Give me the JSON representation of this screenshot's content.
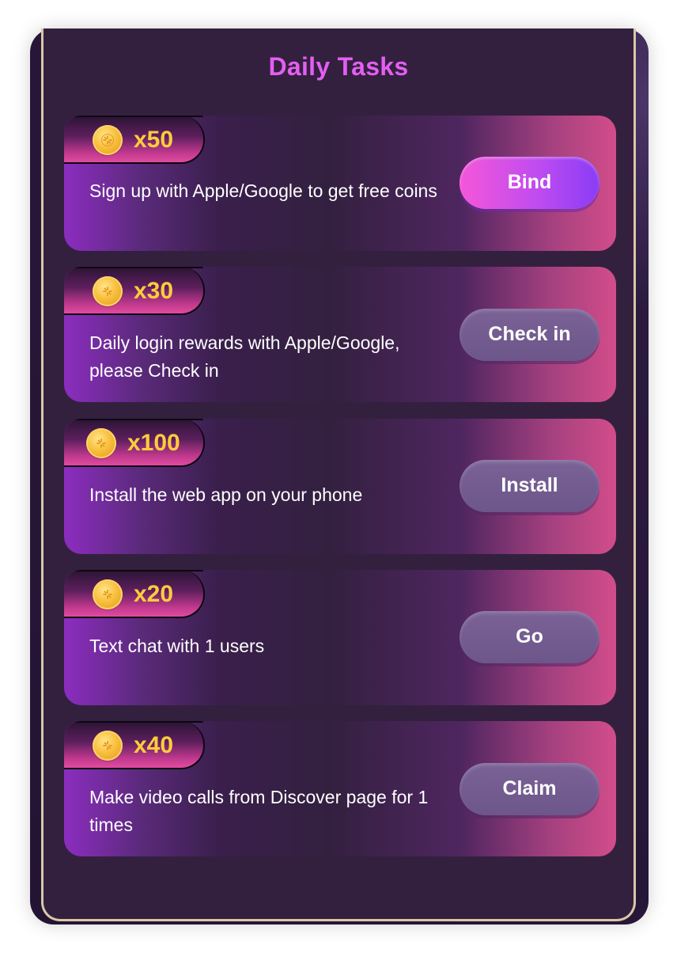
{
  "title": "Daily Tasks",
  "tasks": [
    {
      "reward": "x50",
      "description": "Sign up with Apple/Google to get free coins",
      "button_label": "Bind",
      "button_style": "primary"
    },
    {
      "reward": "x30",
      "description": "Daily login rewards with Apple/Google, please Check in",
      "button_label": "Check in",
      "button_style": "muted"
    },
    {
      "reward": "x100",
      "description": "Install the web app on your phone",
      "button_label": "Install",
      "button_style": "muted"
    },
    {
      "reward": "x20",
      "description": "Text chat with 1 users",
      "button_label": "Go",
      "button_style": "muted"
    },
    {
      "reward": "x40",
      "description": "Make video calls from Discover page for 1 times",
      "button_label": "Claim",
      "button_style": "muted"
    }
  ],
  "colors": {
    "title": "#e45ef2",
    "reward_text": "#ffcc3c",
    "modal_bg": "#33203f",
    "accent_pink": "#d24d8a",
    "button_primary": "#c04cf0",
    "button_muted": "#7a6296"
  },
  "icons": {
    "coin": "coin-icon"
  }
}
